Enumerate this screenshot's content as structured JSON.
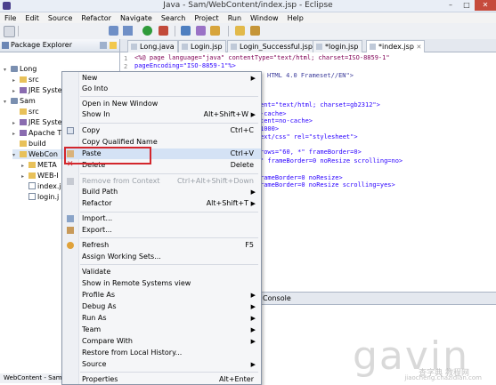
{
  "window": {
    "title": "Java - Sam/WebContent/index.jsp - Eclipse",
    "controls": [
      "–",
      "□",
      "✕"
    ]
  },
  "menubar": [
    "File",
    "Edit",
    "Source",
    "Refactor",
    "Navigate",
    "Search",
    "Project",
    "Run",
    "Window",
    "Help"
  ],
  "package_explorer": {
    "title": "Package Explorer",
    "tree": [
      {
        "label": "Long",
        "icon": "project-icon",
        "twisty": "▾"
      },
      {
        "label": "src",
        "icon": "folder-icon",
        "twisty": "▸"
      },
      {
        "label": "JRE Syste",
        "icon": "library-icon",
        "twisty": "▸"
      },
      {
        "label": "Sam",
        "icon": "project-icon",
        "twisty": "▾"
      },
      {
        "label": "src",
        "icon": "folder-icon",
        "twisty": ""
      },
      {
        "label": "JRE Syste",
        "icon": "library-icon",
        "twisty": "▸"
      },
      {
        "label": "Apache T",
        "icon": "library-icon",
        "twisty": "▸"
      },
      {
        "label": "build",
        "icon": "folder-icon",
        "twisty": ""
      },
      {
        "label": "WebCon",
        "icon": "folder-icon",
        "twisty": "▾"
      },
      {
        "label": "META",
        "icon": "folder-icon",
        "twisty": "▸"
      },
      {
        "label": "WEB-I",
        "icon": "folder-icon",
        "twisty": "▸"
      },
      {
        "label": "index.j",
        "icon": "file-icon",
        "twisty": ""
      },
      {
        "label": "login.j",
        "icon": "file-icon",
        "twisty": ""
      }
    ]
  },
  "editor": {
    "tabs": [
      {
        "label": "Long.java",
        "active": false
      },
      {
        "label": "Login.jsp",
        "active": false
      },
      {
        "label": "Login_Successful.jsp",
        "active": false
      },
      {
        "label": "*login.jsp",
        "active": false
      },
      {
        "label": "*index.jsp",
        "active": true
      }
    ],
    "lines": [
      {
        "n": "1",
        "text": "<%@ page language=\"java\" contentType=\"text/html; charset=ISO-8859-1\""
      },
      {
        "n": "2",
        "text": "    pageEncoding=\"ISO-8859-1\"%>"
      },
      {
        "n": "",
        "text": "HTML 4.0 Frameset//EN\">"
      },
      {
        "n": "",
        "text": "ent=\"text/html; charset=gb2312\">"
      },
      {
        "n": "",
        "text": "-cache>"
      },
      {
        "n": "",
        "text": "tent=no-cache>"
      },
      {
        "n": "",
        "text": "1000>"
      },
      {
        "n": "",
        "text": "ext/css\" rel=\"stylesheet\">"
      },
      {
        "n": "",
        "text": "rows=\"60, *\" frameBorder=0>"
      },
      {
        "n": "",
        "text": "\" frameBorder=0 noResize scrolling=no>"
      },
      {
        "n": "",
        "text": "rameBorder=0 noResize>"
      },
      {
        "n": "",
        "text": "rameBorder=0 noResize scrolling=yes>"
      }
    ]
  },
  "console": {
    "tab_label": "Console"
  },
  "status": {
    "text": "WebContent - Sam"
  },
  "watermark": {
    "main": "gavin",
    "sub": "查字典 教程网",
    "url": "jiaocheng.chazidian.com"
  },
  "context_menu": {
    "items": [
      {
        "label": "New",
        "shortcut": "",
        "submenu": true,
        "disabled": false,
        "icon": ""
      },
      {
        "label": "Go Into",
        "shortcut": "",
        "submenu": false,
        "disabled": false,
        "icon": ""
      },
      {
        "sep": true
      },
      {
        "label": "Open in New Window",
        "shortcut": "",
        "submenu": false,
        "disabled": false,
        "icon": ""
      },
      {
        "label": "Show In",
        "shortcut": "Alt+Shift+W",
        "submenu": true,
        "disabled": false,
        "icon": ""
      },
      {
        "sep": true
      },
      {
        "label": "Copy",
        "shortcut": "Ctrl+C",
        "submenu": false,
        "disabled": false,
        "icon": "copy-icon"
      },
      {
        "label": "Copy Qualified Name",
        "shortcut": "",
        "submenu": false,
        "disabled": false,
        "icon": ""
      },
      {
        "label": "Paste",
        "shortcut": "Ctrl+V",
        "submenu": false,
        "disabled": false,
        "icon": "paste-icon",
        "highlight": true
      },
      {
        "label": "Delete",
        "shortcut": "Delete",
        "submenu": false,
        "disabled": false,
        "icon": "delete-icon"
      },
      {
        "sep": true
      },
      {
        "label": "Remove from Context",
        "shortcut": "Ctrl+Alt+Shift+Down",
        "submenu": false,
        "disabled": true,
        "icon": "remove-context-icon"
      },
      {
        "label": "Build Path",
        "shortcut": "",
        "submenu": true,
        "disabled": false,
        "icon": ""
      },
      {
        "label": "Refactor",
        "shortcut": "Alt+Shift+T",
        "submenu": true,
        "disabled": false,
        "icon": ""
      },
      {
        "sep": true
      },
      {
        "label": "Import...",
        "shortcut": "",
        "submenu": false,
        "disabled": false,
        "icon": "import-icon"
      },
      {
        "label": "Export...",
        "shortcut": "",
        "submenu": false,
        "disabled": false,
        "icon": "export-icon"
      },
      {
        "sep": true
      },
      {
        "label": "Refresh",
        "shortcut": "F5",
        "submenu": false,
        "disabled": false,
        "icon": "refresh-icon"
      },
      {
        "label": "Assign Working Sets...",
        "shortcut": "",
        "submenu": false,
        "disabled": false,
        "icon": ""
      },
      {
        "sep": true
      },
      {
        "label": "Validate",
        "shortcut": "",
        "submenu": false,
        "disabled": false,
        "icon": ""
      },
      {
        "label": "Show in Remote Systems view",
        "shortcut": "",
        "submenu": false,
        "disabled": false,
        "icon": ""
      },
      {
        "label": "Profile As",
        "shortcut": "",
        "submenu": true,
        "disabled": false,
        "icon": ""
      },
      {
        "label": "Debug As",
        "shortcut": "",
        "submenu": true,
        "disabled": false,
        "icon": ""
      },
      {
        "label": "Run As",
        "shortcut": "",
        "submenu": true,
        "disabled": false,
        "icon": ""
      },
      {
        "label": "Team",
        "shortcut": "",
        "submenu": true,
        "disabled": false,
        "icon": ""
      },
      {
        "label": "Compare With",
        "shortcut": "",
        "submenu": true,
        "disabled": false,
        "icon": ""
      },
      {
        "label": "Restore from Local History...",
        "shortcut": "",
        "submenu": false,
        "disabled": false,
        "icon": ""
      },
      {
        "label": "Source",
        "shortcut": "",
        "submenu": true,
        "disabled": false,
        "icon": ""
      },
      {
        "sep": true
      },
      {
        "label": "Properties",
        "shortcut": "Alt+Enter",
        "submenu": false,
        "disabled": false,
        "icon": ""
      }
    ]
  },
  "colors": {
    "highlight_box": "#d3262c",
    "selection": "#dde8f6"
  }
}
